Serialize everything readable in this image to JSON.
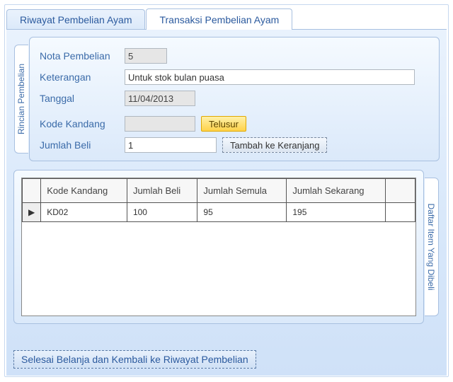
{
  "tabs": {
    "history": "Riwayat Pembelian Ayam",
    "transaction": "Transaksi Pembelian Ayam"
  },
  "formSide": "Rincian Pembelian",
  "labels": {
    "nota": "Nota Pembelian",
    "ket": "Keterangan",
    "tgl": "Tanggal",
    "kode": "Kode Kandang",
    "jml": "Jumlah Beli"
  },
  "values": {
    "nota": "5",
    "ket": "Untuk stok bulan puasa",
    "tgl": "11/04/2013",
    "kode": "",
    "jml": "1"
  },
  "buttons": {
    "telusur": "Telusur",
    "tambah": "Tambah ke Keranjang",
    "finish": "Selesai Belanja dan Kembali ke Riwayat Pembelian"
  },
  "gridSide": "Daftar Item Yang Dibeli",
  "grid": {
    "headers": {
      "kode": "Kode Kandang",
      "jml": "Jumlah Beli",
      "semula": "Jumlah Semula",
      "sekarang": "Jumlah Sekarang"
    },
    "rows": [
      {
        "marker": "▶",
        "kode": "KD02",
        "jml": "100",
        "semula": "95",
        "sekarang": "195"
      }
    ]
  }
}
